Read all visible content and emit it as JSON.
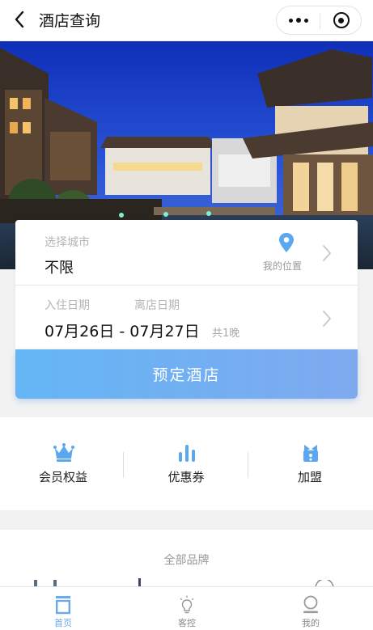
{
  "navbar": {
    "title": "酒店查询",
    "back_icon": "chevron-left-icon",
    "more_icon": "more-dots-icon",
    "close_icon": "target-circle-icon"
  },
  "banner": {
    "description_icon": "hotel-courtyard-photo"
  },
  "search": {
    "city_label": "选择城市",
    "city_value": "不限",
    "location_label": "我的位置",
    "location_icon": "location-pin-icon",
    "checkin_label": "入住日期",
    "checkout_label": "离店日期",
    "date_range": "07月26日 - 07月27日",
    "nights": "共1晚",
    "book_button": "预定酒店"
  },
  "quick_actions": [
    {
      "label": "会员权益",
      "icon": "crown-icon"
    },
    {
      "label": "优惠券",
      "icon": "bar-chart-icon"
    },
    {
      "label": "加盟",
      "icon": "gift-bow-icon"
    }
  ],
  "brands": {
    "title": "全部品牌"
  },
  "tabbar": [
    {
      "label": "首页",
      "icon": "home-icon",
      "active": true
    },
    {
      "label": "客控",
      "icon": "lightbulb-icon",
      "active": false
    },
    {
      "label": "我的",
      "icon": "user-icon",
      "active": false
    }
  ],
  "colors": {
    "accent": "#6aa9ee",
    "button_start": "#64b6f5",
    "button_end": "#7fa9ef",
    "location_pin": "#5aa8f0"
  }
}
